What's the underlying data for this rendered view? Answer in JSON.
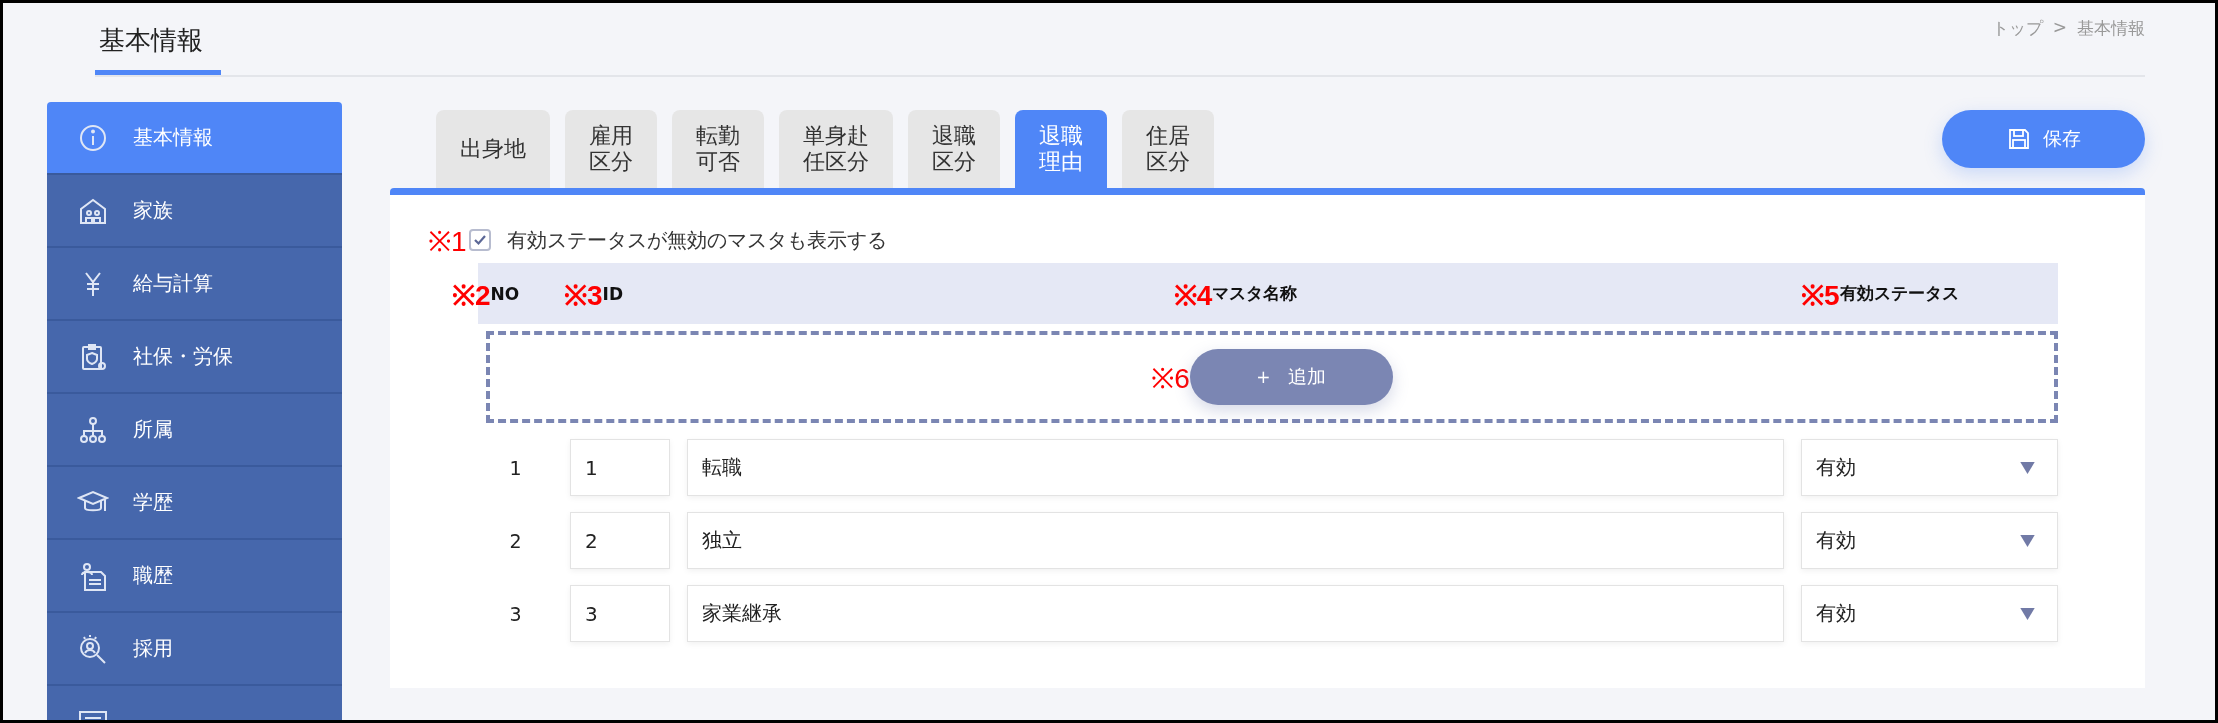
{
  "header": {
    "title": "基本情報",
    "breadcrumb": [
      {
        "label": "トップ"
      },
      {
        "label": "基本情報"
      }
    ],
    "separator": ">"
  },
  "sidebar": {
    "items": [
      {
        "label": "基本情報",
        "selected": true
      },
      {
        "label": "家族",
        "selected": false
      },
      {
        "label": "給与計算",
        "selected": false
      },
      {
        "label": "社保・労保",
        "selected": false
      },
      {
        "label": "所属",
        "selected": false
      },
      {
        "label": "学歴",
        "selected": false
      },
      {
        "label": "職歴",
        "selected": false
      },
      {
        "label": "採用",
        "selected": false
      }
    ]
  },
  "tabs": [
    {
      "label": "出身地",
      "selected": false
    },
    {
      "label": "雇用区分",
      "selected": false
    },
    {
      "label": "転勤可否",
      "selected": false
    },
    {
      "label": "単身赴任区分",
      "selected": false
    },
    {
      "label": "退職区分",
      "selected": false
    },
    {
      "label": "退職理由",
      "selected": true
    },
    {
      "label": "住居区分",
      "selected": false
    }
  ],
  "save_button": {
    "label": "保存"
  },
  "show_inactive": {
    "marker": "※1",
    "label": "有効ステータスが無効のマスタも表示する",
    "checked": true
  },
  "columns": [
    {
      "marker": "※2",
      "label": "NO"
    },
    {
      "marker": "※3",
      "label": "ID"
    },
    {
      "marker": "※4",
      "label": "マスタ名称"
    },
    {
      "marker": "※5",
      "label": "有効ステータス"
    }
  ],
  "add_button": {
    "marker": "※6",
    "symbol": "+",
    "label": "追加"
  },
  "rows": [
    {
      "no": "1",
      "id": "1",
      "name": "転職",
      "status": "有効"
    },
    {
      "no": "2",
      "id": "2",
      "name": "独立",
      "status": "有効"
    },
    {
      "no": "3",
      "id": "3",
      "name": "家業継承",
      "status": "有効"
    }
  ]
}
